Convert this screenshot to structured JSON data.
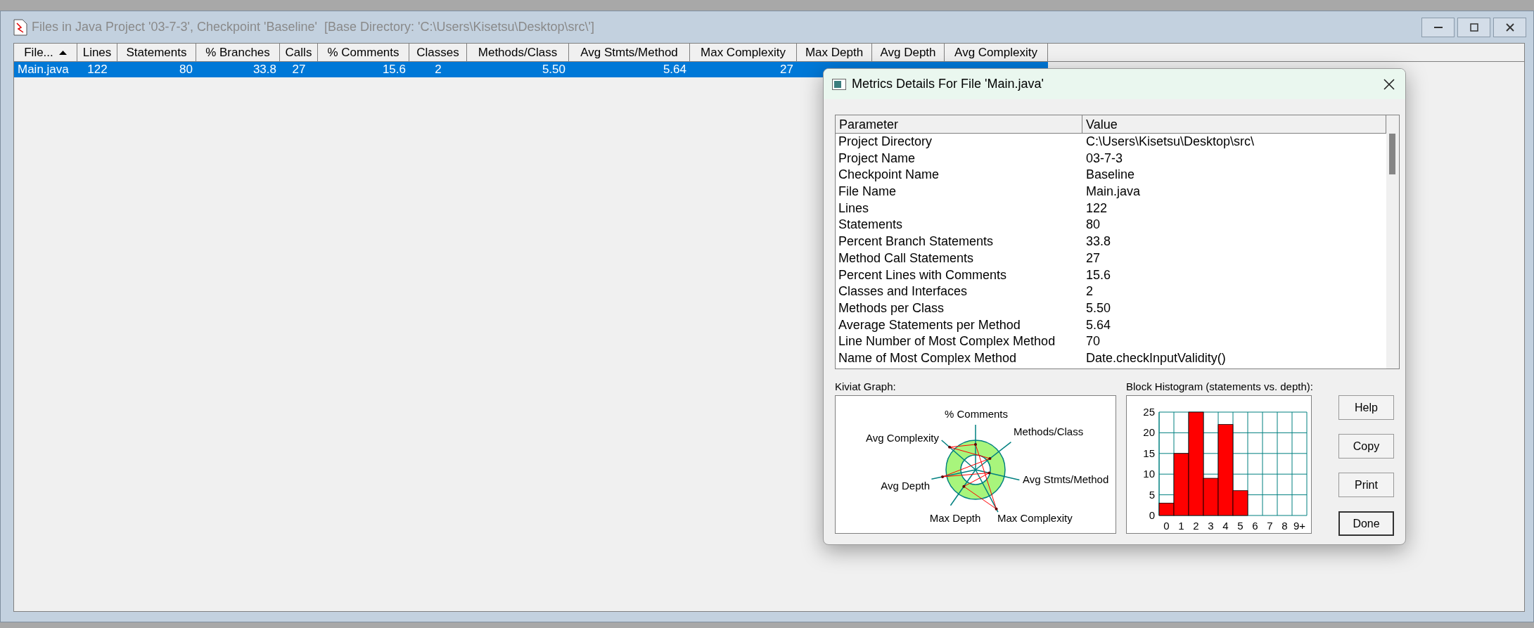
{
  "window": {
    "title": "Files in Java Project '03-7-3', Checkpoint 'Baseline'  [Base Directory: 'C:\\Users\\Kisetsu\\Desktop\\src\\']"
  },
  "table": {
    "columns": [
      {
        "label": "File...",
        "sorted": true
      },
      {
        "label": "Lines",
        "sorted": false
      },
      {
        "label": "Statements",
        "sorted": false
      },
      {
        "label": "% Branches",
        "sorted": false
      },
      {
        "label": "Calls",
        "sorted": false
      },
      {
        "label": "% Comments",
        "sorted": false
      },
      {
        "label": "Classes",
        "sorted": false
      },
      {
        "label": "Methods/Class",
        "sorted": false
      },
      {
        "label": "Avg Stmts/Method",
        "sorted": false
      },
      {
        "label": "Max Complexity",
        "sorted": false
      },
      {
        "label": "Max Depth",
        "sorted": false
      },
      {
        "label": "Avg Depth",
        "sorted": false
      },
      {
        "label": "Avg Complexity",
        "sorted": false
      }
    ],
    "rows": [
      {
        "selected": true,
        "cells": [
          "Main.java",
          "122",
          "80",
          "33.8",
          "27",
          "15.6",
          "2",
          "5.50",
          "5.64",
          "27"
        ]
      }
    ]
  },
  "dialog": {
    "title": "Metrics Details For File 'Main.java'",
    "details": {
      "columns": [
        "Parameter",
        "Value"
      ],
      "rows": [
        [
          "Project Directory",
          "C:\\Users\\Kisetsu\\Desktop\\src\\"
        ],
        [
          "Project Name",
          "03-7-3"
        ],
        [
          "Checkpoint Name",
          "Baseline"
        ],
        [
          "File Name",
          "Main.java"
        ],
        [
          "Lines",
          "122"
        ],
        [
          "Statements",
          "80"
        ],
        [
          "Percent Branch Statements",
          "33.8"
        ],
        [
          "Method Call Statements",
          "27"
        ],
        [
          "Percent Lines with Comments",
          "15.6"
        ],
        [
          "Classes and Interfaces",
          "2"
        ],
        [
          "Methods per Class",
          "5.50"
        ],
        [
          "Average Statements per Method",
          "5.64"
        ],
        [
          "Line Number of Most Complex Method",
          "70"
        ],
        [
          "Name of Most Complex Method",
          "Date.checkInputValidity()"
        ]
      ]
    },
    "kiviat": {
      "label": "Kiviat Graph:",
      "axes": [
        "% Comments",
        "Avg Complexity",
        "Methods/Class",
        "Avg Depth",
        "Avg Stmts/Method",
        "Max Depth",
        "Max Complexity"
      ]
    },
    "histogram": {
      "label": "Block Histogram (statements vs. depth):",
      "chart_data": {
        "type": "bar",
        "categories": [
          "0",
          "1",
          "2",
          "3",
          "4",
          "5",
          "6",
          "7",
          "8",
          "9+"
        ],
        "series": [
          {
            "color": "#ff0000",
            "values": [
              3,
              15,
              25,
              9,
              22,
              6,
              0,
              0,
              0,
              0
            ]
          }
        ],
        "ylim": [
          0,
          25
        ],
        "yticks": [
          0,
          5,
          10,
          15,
          20,
          25
        ],
        "grid": true
      }
    },
    "buttons": [
      {
        "label": "Help",
        "default": false
      },
      {
        "label": "Copy",
        "default": false
      },
      {
        "label": "Print",
        "default": false
      },
      {
        "label": "Done",
        "default": true
      }
    ]
  }
}
